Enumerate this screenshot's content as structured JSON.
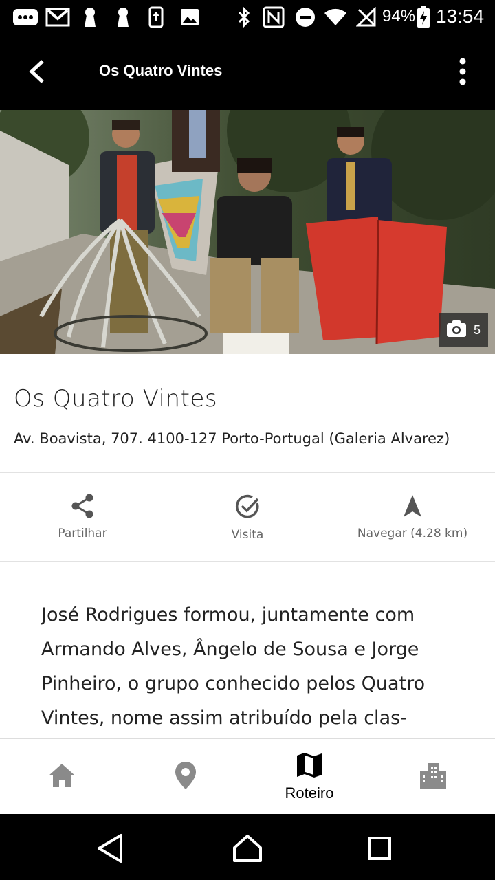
{
  "status_bar": {
    "battery": "94%",
    "time": "13:54"
  },
  "toolbar": {
    "title": "Os Quatro Vintes"
  },
  "hero": {
    "photo_count": "5"
  },
  "place": {
    "title": "Os Quatro Vintes",
    "address": "Av. Boavista, 707. 4100-127 Porto-Portugal (Galeria Alvarez)"
  },
  "actions": {
    "share": "Partilhar",
    "visit": "Visita",
    "navigate": "Navegar (4.28 km)"
  },
  "description": "José Rodrigues formou, juntamente com Armando Alves, Ângelo de Sousa e Jorge Pinheiro, o grupo conhecido pelos Quatro Vintes, nome assim atribuído pela clas-",
  "bottom_nav": {
    "active_label": "Roteiro"
  },
  "colors": {
    "bar_bg": "#000000",
    "icon_gray": "#8a8a8a",
    "text_dark": "#222222"
  }
}
